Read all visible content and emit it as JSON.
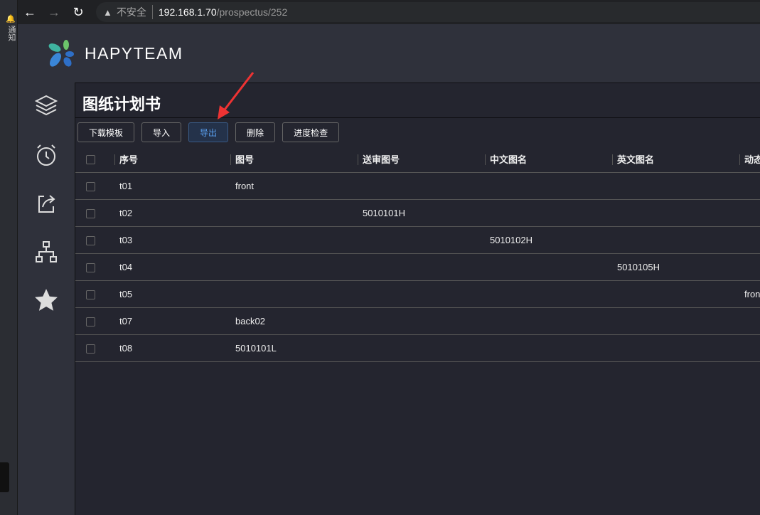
{
  "browser": {
    "insecure_label": "不安全",
    "url_host": "192.168.1.70",
    "url_path": "/prospectus/252",
    "notification_label": "通知"
  },
  "app": {
    "brand": "HAPYTEAM"
  },
  "sidebar": {
    "items": [
      {
        "icon": "layers-icon"
      },
      {
        "icon": "alarm-clock-icon"
      },
      {
        "icon": "share-icon"
      },
      {
        "icon": "org-chart-icon"
      },
      {
        "icon": "star-icon"
      }
    ]
  },
  "page": {
    "title": "图纸计划书"
  },
  "toolbar": {
    "buttons": [
      "下载模板",
      "导入",
      "导出",
      "删除",
      "进度检查"
    ],
    "active": "导出",
    "accent": "#5aa0f0"
  },
  "table": {
    "columns": [
      "序号",
      "图号",
      "送审图号",
      "中文图名",
      "英文图名",
      "动态"
    ],
    "rows": [
      [
        "t01",
        "front",
        "",
        "",
        "",
        ""
      ],
      [
        "t02",
        "",
        "5010101H",
        "",
        "",
        ""
      ],
      [
        "t03",
        "",
        "",
        "5010102H",
        "",
        ""
      ],
      [
        "t04",
        "",
        "",
        "",
        "5010105H",
        ""
      ],
      [
        "t05",
        "",
        "",
        "",
        "",
        "fron"
      ],
      [
        "t07",
        "back02",
        "",
        "",
        "",
        ""
      ],
      [
        "t08",
        "5010101L",
        "",
        "",
        "",
        ""
      ]
    ]
  }
}
